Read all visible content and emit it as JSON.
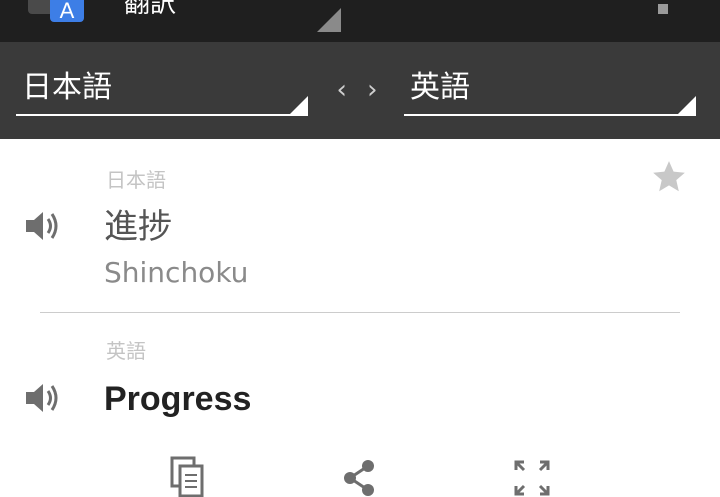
{
  "app": {
    "title": "翻訳",
    "icon": "translate-app-icon",
    "overflow_icon": "overflow-menu-icon"
  },
  "language_bar": {
    "source_language": "日本語",
    "target_language": "英語",
    "swap_label": "‹ ›",
    "swap_icon": "swap-languages-icon"
  },
  "source": {
    "language_label": "日本語",
    "text": "進捗",
    "romanization": "Shinchoku",
    "speaker_icon": "speaker-icon",
    "star_icon": "star-icon"
  },
  "translation": {
    "language_label": "英語",
    "text": "Progress",
    "speaker_icon": "speaker-icon"
  },
  "actions": [
    {
      "name": "copy",
      "icon": "copy-icon"
    },
    {
      "name": "share",
      "icon": "share-icon"
    },
    {
      "name": "fullscreen",
      "icon": "fullscreen-icon"
    }
  ],
  "colors": {
    "action_bar": "#1f1f1f",
    "language_bar": "#3a3a3a",
    "icon_gray": "#6e6e6e",
    "accent_blue": "#3d7ee6"
  }
}
